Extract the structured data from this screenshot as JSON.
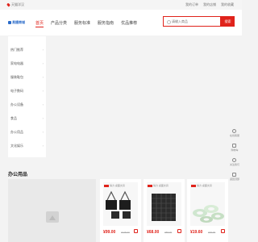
{
  "topbar": {
    "location": "天猫洋汉",
    "links": [
      "我的订单",
      "我的店铺",
      "我的收藏"
    ]
  },
  "header": {
    "logo_text": "易捷商城",
    "nav": [
      "首页",
      "产品分类",
      "服务标准",
      "服务指南",
      "优品推荐"
    ],
    "search_placeholder": "请输入商品",
    "search_button": "搜索"
  },
  "sidebar": {
    "items": [
      "热门推荐",
      "家电电器",
      "服装鞋包",
      "电子数码",
      "办公设备",
      "食品",
      "办公用品",
      "文化娱乐"
    ]
  },
  "right_bar": {
    "items": [
      {
        "label": "在线客服",
        "icon": "chat-icon"
      },
      {
        "label": "购物车",
        "icon": "cart-icon"
      },
      {
        "label": "关注我们",
        "icon": "star-icon"
      },
      {
        "label": "返回顶部",
        "icon": "top-icon"
      }
    ]
  },
  "section": {
    "title": "办公用品"
  },
  "products": [
    {
      "brand": "得力 桌面文具",
      "price": "¥99.00",
      "old_price": "¥125.00"
    },
    {
      "brand": "得力 桌面文具",
      "price": "¥68.00",
      "old_price": "¥88.00"
    },
    {
      "brand": "得力 桌面文具",
      "price": "¥19.60",
      "old_price": "¥25.00"
    }
  ],
  "colors": {
    "accent": "#e0231b",
    "logo": "#2a6bc9"
  }
}
